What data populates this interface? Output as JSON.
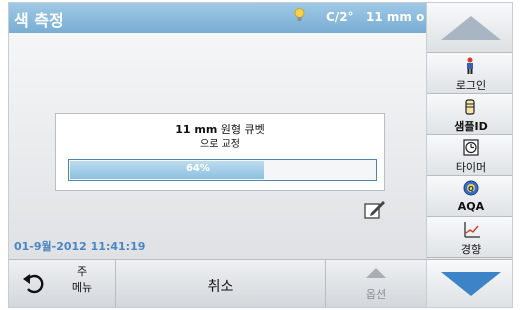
{
  "header": {
    "title": "색 측정",
    "temperature": "C/2°",
    "time_label": "11 mm o",
    "bulb_icon": "lamp-icon"
  },
  "dialog": {
    "message_bold": "11 mm",
    "message_rest": "원형 큐벳",
    "message_line2": "으로 교정",
    "progress_percent": 64,
    "progress_label": "64%"
  },
  "status": {
    "datetime": "01-9월-2012  11:41:19"
  },
  "bottom_bar": {
    "main_menu_line1": "주",
    "main_menu_line2": "메뉴",
    "cancel_label": "취소",
    "options_label": "옵션"
  },
  "sidebar": {
    "items": [
      {
        "label": "로그인",
        "icon": "person-icon"
      },
      {
        "label": "샘플ID",
        "icon": "sample-vial-icon"
      },
      {
        "label": "타이머",
        "icon": "timer-icon"
      },
      {
        "label": "AQA",
        "icon": "aqa-icon"
      },
      {
        "label": "경향",
        "icon": "trend-chart-icon"
      }
    ]
  },
  "colors": {
    "header": "#78add2",
    "accent_blue": "#3c84c7",
    "date_text": "#4a86c3"
  }
}
